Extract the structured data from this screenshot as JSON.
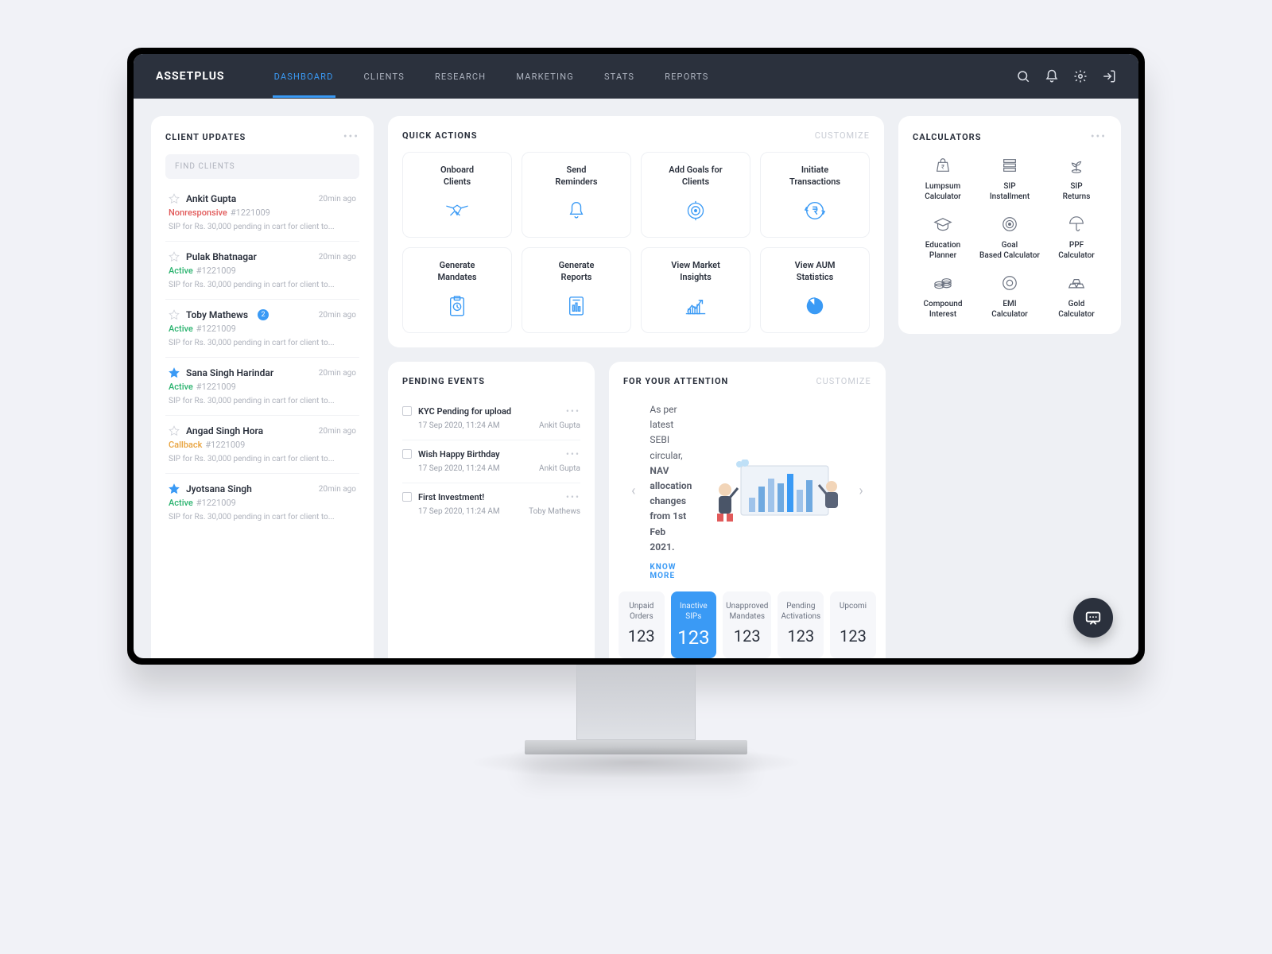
{
  "brand": "ASSETPLUS",
  "nav": [
    "DASHBOARD",
    "CLIENTS",
    "RESEARCH",
    "MARKETING",
    "STATS",
    "REPORTS"
  ],
  "nav_active": 0,
  "client_updates": {
    "title": "CLIENT UPDATES",
    "search_placeholder": "FIND CLIENTS",
    "items": [
      {
        "star": false,
        "name": "Ankit Gupta",
        "time": "20min ago",
        "status": "Nonresponsive",
        "id": "#1221009",
        "desc": "SIP for Rs. 30,000 pending in cart for client to...",
        "badge": null
      },
      {
        "star": false,
        "name": "Pulak Bhatnagar",
        "time": "20min ago",
        "status": "Active",
        "id": "#1221009",
        "desc": "SIP for Rs. 30,000 pending in cart for client to...",
        "badge": null
      },
      {
        "star": false,
        "name": "Toby Mathews",
        "time": "20min ago",
        "status": "Active",
        "id": "#1221009",
        "desc": "SIP for Rs. 30,000 pending in cart for client to...",
        "badge": "2"
      },
      {
        "star": true,
        "name": "Sana Singh Harindar",
        "time": "20min ago",
        "status": "Active",
        "id": "#1221009",
        "desc": "SIP for Rs. 30,000 pending in cart for client to...",
        "badge": null
      },
      {
        "star": false,
        "name": "Angad Singh Hora",
        "time": "20min ago",
        "status": "Callback",
        "id": "#1221009",
        "desc": "SIP for Rs. 30,000 pending in cart for client to...",
        "badge": null
      },
      {
        "star": true,
        "name": "Jyotsana Singh",
        "time": "20min ago",
        "status": "Active",
        "id": "#1221009",
        "desc": "SIP for Rs. 30,000 pending in cart for client to...",
        "badge": null
      }
    ]
  },
  "quick_actions": {
    "title": "QUICK ACTIONS",
    "customize": "CUSTOMIZE",
    "items": [
      {
        "label": "Onboard Clients",
        "icon": "handshake"
      },
      {
        "label": "Send Reminders",
        "icon": "bell"
      },
      {
        "label": "Add Goals for Clients",
        "icon": "target"
      },
      {
        "label": "Initiate Transactions",
        "icon": "rupee-cycle"
      },
      {
        "label": "Generate Mandates",
        "icon": "clipboard"
      },
      {
        "label": "Generate Reports",
        "icon": "report"
      },
      {
        "label": "View Market Insights",
        "icon": "chart-up"
      },
      {
        "label": "View AUM Statistics",
        "icon": "pie"
      }
    ]
  },
  "calculators": {
    "title": "CALCULATORS",
    "items": [
      {
        "label": "Lumpsum Calculator",
        "icon": "bag"
      },
      {
        "label": "SIP Installment",
        "icon": "stack"
      },
      {
        "label": "SIP Returns",
        "icon": "plant"
      },
      {
        "label": "Education Planner",
        "icon": "grad-cap"
      },
      {
        "label": "Goal Based Calculator",
        "icon": "bullseye"
      },
      {
        "label": "PPF Calculator",
        "icon": "umbrella"
      },
      {
        "label": "Compound Interest",
        "icon": "coins"
      },
      {
        "label": "EMI Calculator",
        "icon": "ring"
      },
      {
        "label": "Gold Calculator",
        "icon": "gold"
      }
    ]
  },
  "pending_events": {
    "title": "PENDING EVENTS",
    "items": [
      {
        "title": "KYC Pending for upload",
        "date": "17 Sep 2020, 11:24 AM",
        "name": "Ankit Gupta"
      },
      {
        "title": "Wish Happy Birthday",
        "date": "17 Sep 2020, 11:24 AM",
        "name": "Ankit Gupta"
      },
      {
        "title": "First Investment!",
        "date": "17 Sep 2020, 11:24 AM",
        "name": "Toby Mathews"
      }
    ]
  },
  "attention": {
    "title": "FOR YOUR ATTENTION",
    "customize": "CUSTOMIZE",
    "banner_pre": "As per latest SEBI circular, ",
    "banner_bold": "NAV allocation changes from 1st Feb 2021.",
    "know_more": "KNOW MORE",
    "cards": [
      {
        "label": "Unpaid Orders",
        "value": "123",
        "active": false
      },
      {
        "label": "Inactive SIPs",
        "value": "123",
        "active": true
      },
      {
        "label": "Unapproved Mandates",
        "value": "123",
        "active": false
      },
      {
        "label": "Pending Activations",
        "value": "123",
        "active": false
      },
      {
        "label": "Upcomi",
        "value": "123",
        "active": false
      }
    ]
  }
}
